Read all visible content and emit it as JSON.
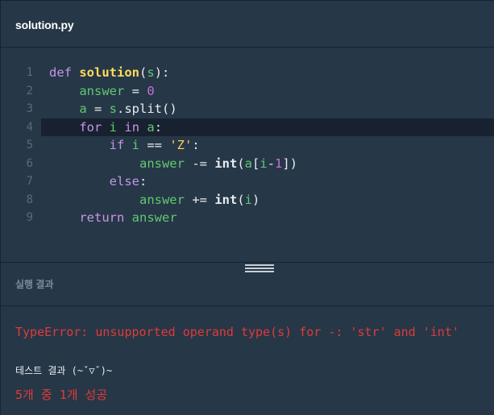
{
  "editor": {
    "filename": "solution.py",
    "lines": [
      {
        "number": "1",
        "tokens": [
          {
            "t": "def",
            "c": "kw"
          },
          {
            "t": " ",
            "c": "op"
          },
          {
            "t": "solution",
            "c": "fn"
          },
          {
            "t": "(",
            "c": "op"
          },
          {
            "t": "s",
            "c": "var"
          },
          {
            "t": "):",
            "c": "op"
          }
        ]
      },
      {
        "number": "2",
        "tokens": [
          {
            "t": "    ",
            "c": "op"
          },
          {
            "t": "answer",
            "c": "var"
          },
          {
            "t": " = ",
            "c": "op"
          },
          {
            "t": "0",
            "c": "num"
          }
        ]
      },
      {
        "number": "3",
        "tokens": [
          {
            "t": "    ",
            "c": "op"
          },
          {
            "t": "a",
            "c": "var"
          },
          {
            "t": " = ",
            "c": "op"
          },
          {
            "t": "s",
            "c": "var"
          },
          {
            "t": ".split()",
            "c": "op"
          }
        ]
      },
      {
        "number": "4",
        "tokens": [
          {
            "t": "    ",
            "c": "op"
          },
          {
            "t": "for",
            "c": "kw"
          },
          {
            "t": " ",
            "c": "op"
          },
          {
            "t": "i",
            "c": "var"
          },
          {
            "t": " ",
            "c": "op"
          },
          {
            "t": "in",
            "c": "kw"
          },
          {
            "t": " ",
            "c": "op"
          },
          {
            "t": "a",
            "c": "var"
          },
          {
            "t": ":",
            "c": "op"
          }
        ]
      },
      {
        "number": "5",
        "tokens": [
          {
            "t": "        ",
            "c": "op"
          },
          {
            "t": "if",
            "c": "kw"
          },
          {
            "t": " ",
            "c": "op"
          },
          {
            "t": "i",
            "c": "var"
          },
          {
            "t": " == ",
            "c": "op"
          },
          {
            "t": "'Z'",
            "c": "str"
          },
          {
            "t": ":",
            "c": "op"
          }
        ]
      },
      {
        "number": "6",
        "tokens": [
          {
            "t": "            ",
            "c": "op"
          },
          {
            "t": "answer",
            "c": "var"
          },
          {
            "t": " -= ",
            "c": "op"
          },
          {
            "t": "int",
            "c": "bi"
          },
          {
            "t": "(",
            "c": "op"
          },
          {
            "t": "a",
            "c": "var"
          },
          {
            "t": "[",
            "c": "op"
          },
          {
            "t": "i",
            "c": "var"
          },
          {
            "t": "-",
            "c": "op"
          },
          {
            "t": "1",
            "c": "num"
          },
          {
            "t": "])",
            "c": "op"
          }
        ]
      },
      {
        "number": "7",
        "tokens": [
          {
            "t": "        ",
            "c": "op"
          },
          {
            "t": "else",
            "c": "kw"
          },
          {
            "t": ":",
            "c": "op"
          }
        ]
      },
      {
        "number": "8",
        "tokens": [
          {
            "t": "            ",
            "c": "op"
          },
          {
            "t": "answer",
            "c": "var"
          },
          {
            "t": " += ",
            "c": "op"
          },
          {
            "t": "int",
            "c": "bi"
          },
          {
            "t": "(",
            "c": "op"
          },
          {
            "t": "i",
            "c": "var"
          },
          {
            "t": ")",
            "c": "op"
          }
        ]
      },
      {
        "number": "9",
        "tokens": [
          {
            "t": "    ",
            "c": "op"
          },
          {
            "t": "return",
            "c": "kw"
          },
          {
            "t": " ",
            "c": "op"
          },
          {
            "t": "answer",
            "c": "var"
          }
        ]
      }
    ],
    "active_line": 4
  },
  "result": {
    "title": "실행 결과",
    "error": "TypeError: unsupported operand type(s) for -: 'str' and 'int'",
    "test_label": "테스트 결과 (~ˇ▽ˇ)~",
    "test_summary": "5개 중 1개 성공"
  },
  "colors": {
    "background": "#263747",
    "border": "#172334",
    "keyword": "#c596e6",
    "function": "#ffdc5a",
    "variable": "#62c873",
    "number": "#c472d6",
    "string": "#ffca5a",
    "error": "#e03a3a"
  }
}
